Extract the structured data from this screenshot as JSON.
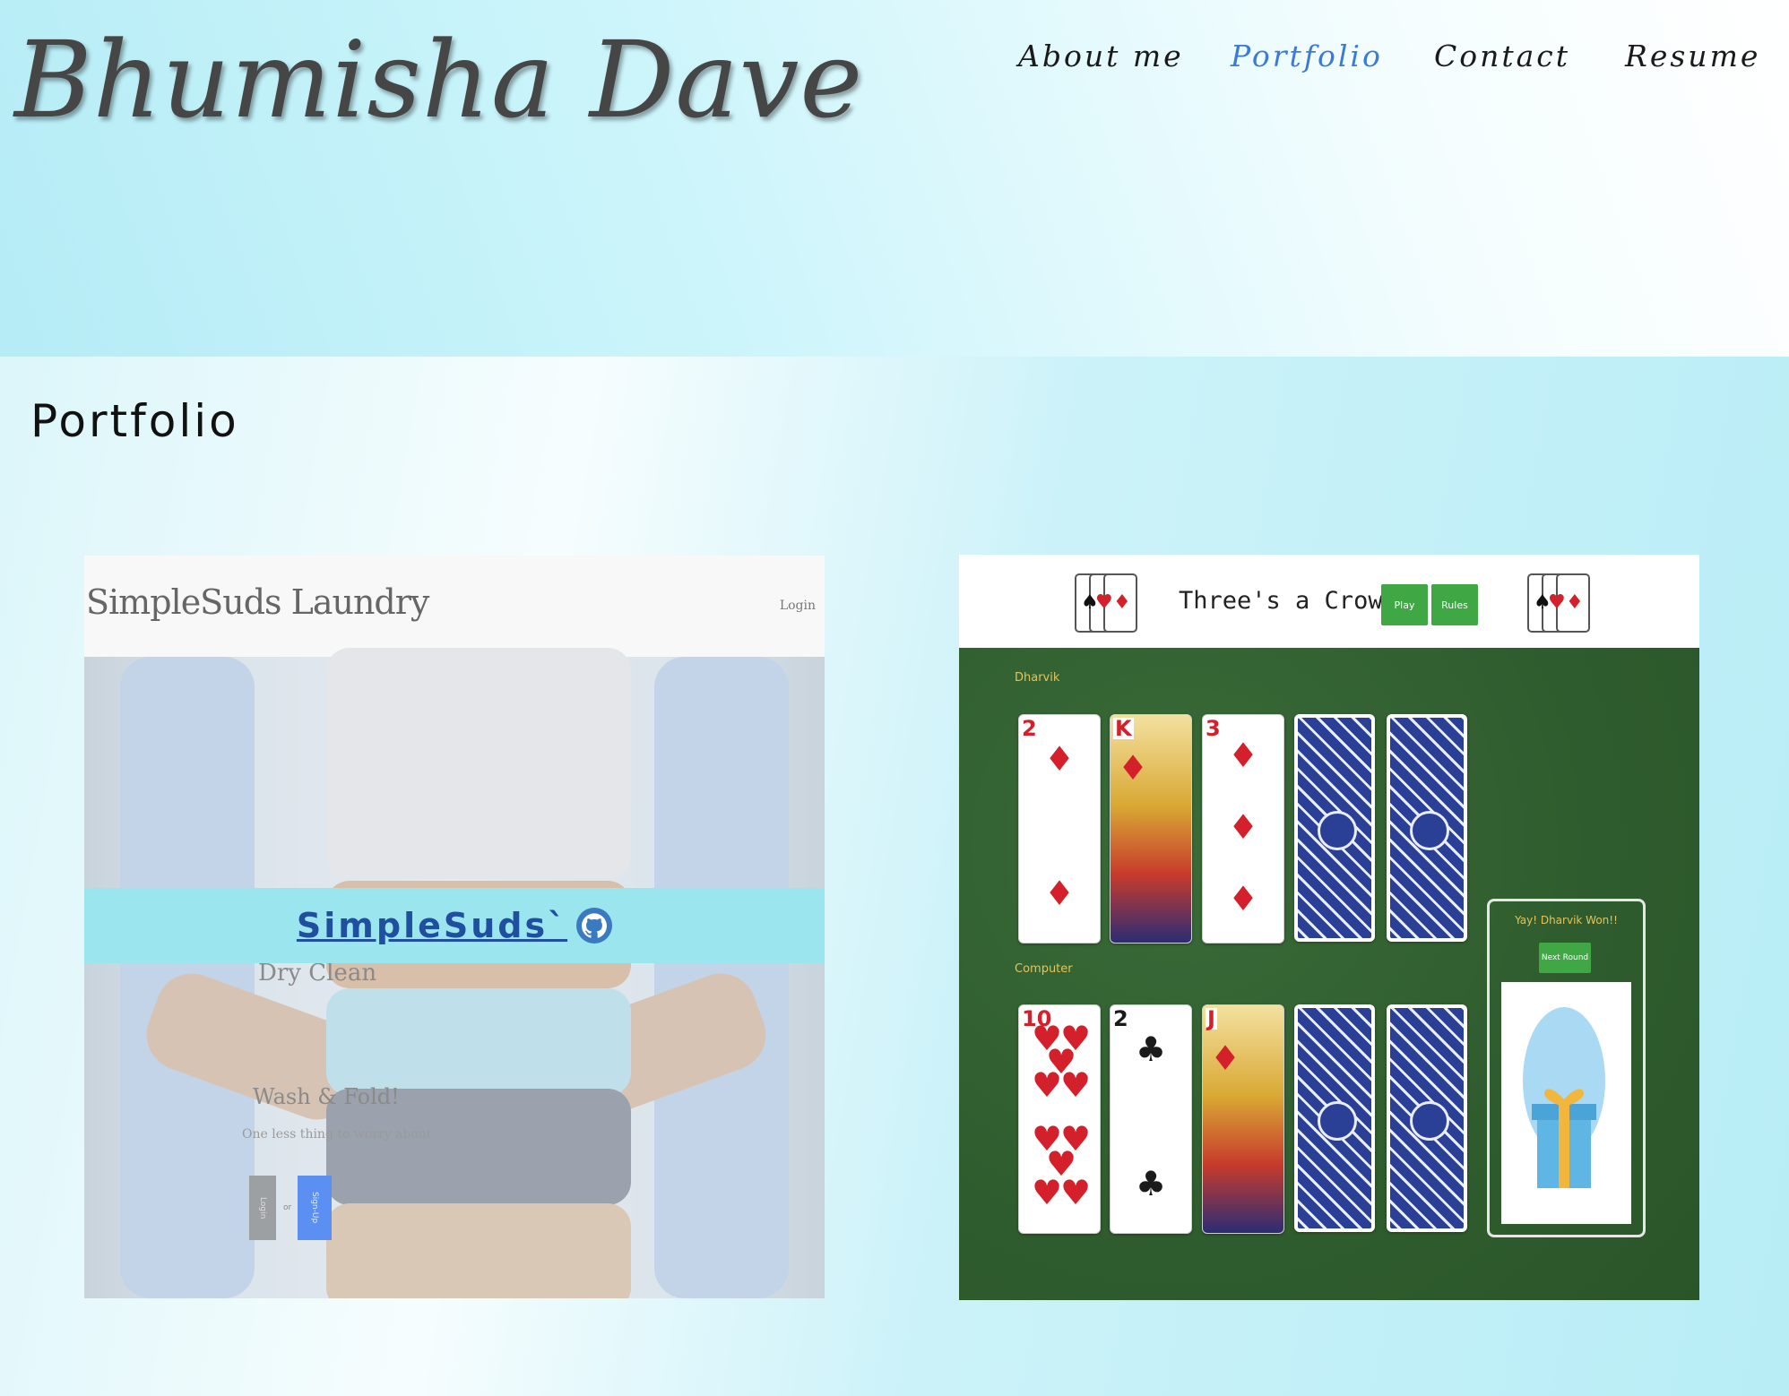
{
  "site": {
    "title": "Bhumisha Dave"
  },
  "nav": {
    "items": [
      "About me",
      "Portfolio",
      "Contact",
      "Resume"
    ],
    "active": "Portfolio"
  },
  "section": {
    "heading": "Portfolio"
  },
  "projects": [
    {
      "name": "SimpleSuds`",
      "link_icon": "github-icon",
      "screenshot": {
        "brand": "SimpleSuds Laundry",
        "login": "Login",
        "tagline_1": "Dry Clean",
        "tagline_2": "Wash & Fold!",
        "tagline_3": "One less thing to worry about",
        "login_button": "Login",
        "or_text": "or",
        "signup_button": "Sign-Up"
      }
    },
    {
      "name": "Three's a Crowd",
      "screenshot": {
        "title": "Three's a Crowd",
        "play_button": "Play",
        "rules_button": "Rules",
        "player_label": "Dharvik",
        "computer_label": "Computer",
        "win_message": "Yay! Dharvik Won!!",
        "next_round_button": "Next Round",
        "player_cards": [
          "2",
          "K",
          "3"
        ],
        "computer_cards": [
          "10",
          "2",
          "J"
        ]
      }
    }
  ],
  "colors": {
    "nav_active": "#3b7ad6",
    "overlay": "#9be5ef",
    "link": "#1f4f9e",
    "felt": "#305e30",
    "button": "#3fa845"
  }
}
